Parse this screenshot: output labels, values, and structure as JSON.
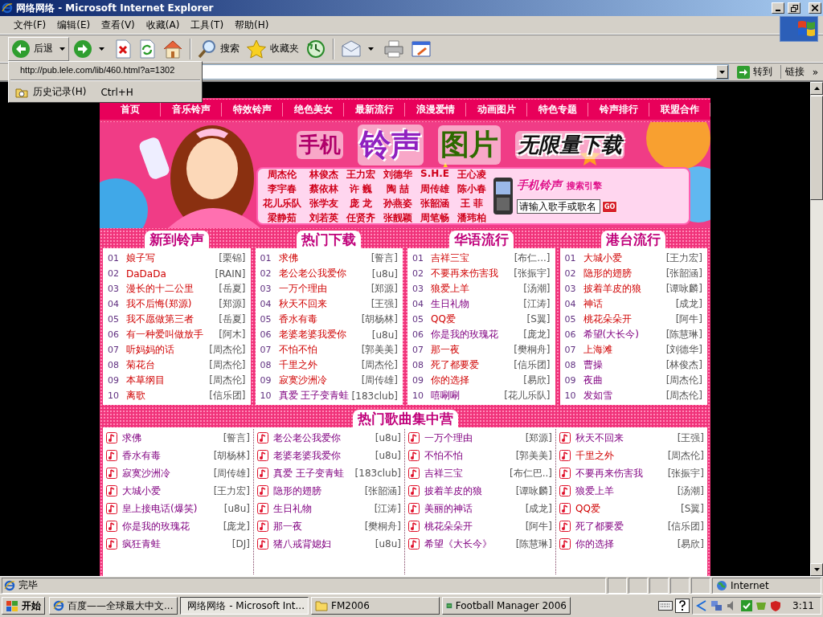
{
  "window": {
    "title": "网络网络 - Microsoft Internet Explorer"
  },
  "menu": [
    "文件(F)",
    "编辑(E)",
    "查看(V)",
    "收藏(A)",
    "工具(T)",
    "帮助(H)"
  ],
  "toolbar": [
    {
      "kind": "back",
      "label": "后退"
    },
    {
      "kind": "forward"
    },
    {
      "kind": "stop"
    },
    {
      "kind": "refresh"
    },
    {
      "kind": "home"
    },
    {
      "kind": "search",
      "label": "搜索"
    },
    {
      "kind": "favorites",
      "label": "收藏夹"
    },
    {
      "kind": "history"
    },
    {
      "kind": "mail"
    },
    {
      "kind": "print"
    },
    {
      "kind": "edit"
    }
  ],
  "address_bar": {
    "go": "转到",
    "links": "链接",
    "chevron": "»"
  },
  "history_menu": {
    "url": "http://pub.lele.com/lib/460.html?a=1302",
    "item": "历史记录(H)",
    "shortcut": "Ctrl+H"
  },
  "page": {
    "nav": [
      "首页",
      "音乐铃声",
      "特效铃声",
      "绝色美女",
      "最新流行",
      "浪漫爱情",
      "动画图片",
      "特色专题",
      "铃声排行",
      "联盟合作"
    ],
    "banner": {
      "headline": [
        "手机",
        "铃声",
        "图片",
        "无限量下载"
      ],
      "singers": [
        "周杰伦",
        "林俊杰",
        "王力宏",
        "刘德华",
        "S.H.E",
        "王心凌",
        "李宇春",
        "蔡依林",
        "许 巍",
        "陶 喆",
        "周传雄",
        "陈小春",
        "花儿乐队",
        "张学友",
        "庞 龙",
        "孙燕姿",
        "张韶涵",
        "王 菲",
        "梁静茹",
        "刘若英",
        "任贤齐",
        "张靓颖",
        "周笔畅",
        "潘玮柏"
      ],
      "search_title": "手机铃声",
      "search_subtitle": "搜索引擎",
      "search_value": "请输入歌手或歌名",
      "go": "GO"
    },
    "panels": [
      {
        "title": "新到铃声",
        "rows": [
          {
            "num": "01",
            "song": "娘子写",
            "artist": "[栗锦]",
            "visited": false
          },
          {
            "num": "02",
            "song": "DaDaDa",
            "artist": "[RAIN]",
            "visited": false
          },
          {
            "num": "03",
            "song": "漫长的十二公里",
            "artist": "[岳夏]",
            "visited": false
          },
          {
            "num": "04",
            "song": "我不后悔(郑源)",
            "artist": "[郑源]",
            "visited": false
          },
          {
            "num": "05",
            "song": "我不愿做第三者",
            "artist": "[岳夏]",
            "visited": false
          },
          {
            "num": "06",
            "song": "有一种爱叫做放手",
            "artist": "[阿木]",
            "visited": false
          },
          {
            "num": "07",
            "song": "听妈妈的话",
            "artist": "[周杰伦]",
            "visited": false
          },
          {
            "num": "08",
            "song": "菊花台",
            "artist": "[周杰伦]",
            "visited": false
          },
          {
            "num": "09",
            "song": "本草纲目",
            "artist": "[周杰伦]",
            "visited": false
          },
          {
            "num": "10",
            "song": "离歌",
            "artist": "[信乐团]",
            "visited": false
          }
        ]
      },
      {
        "title": "热门下载",
        "rows": [
          {
            "num": "01",
            "song": "求佛",
            "artist": "[誓言]",
            "visited": false
          },
          {
            "num": "02",
            "song": "老公老公我爱你",
            "artist": "[u8u]",
            "visited": false
          },
          {
            "num": "03",
            "song": "一万个理由",
            "artist": "[郑源]",
            "visited": false
          },
          {
            "num": "04",
            "song": "秋天不回来",
            "artist": "[王强]",
            "visited": false
          },
          {
            "num": "05",
            "song": "香水有毒",
            "artist": "[胡杨林]",
            "visited": false
          },
          {
            "num": "06",
            "song": "老婆老婆我爱你",
            "artist": "[u8u]",
            "visited": false
          },
          {
            "num": "07",
            "song": "不怕不怕",
            "artist": "[郭美美]",
            "visited": false
          },
          {
            "num": "08",
            "song": "千里之外",
            "artist": "[周杰伦]",
            "visited": false
          },
          {
            "num": "09",
            "song": "寂寞沙洲冷",
            "artist": "[周传雄]",
            "visited": false
          },
          {
            "num": "10",
            "song": "真爱 王子变青蛙",
            "artist": "[183club]",
            "visited": true
          }
        ]
      },
      {
        "title": "华语流行",
        "rows": [
          {
            "num": "01",
            "song": "吉祥三宝",
            "artist": "[布仁...]",
            "visited": false
          },
          {
            "num": "02",
            "song": "不要再来伤害我",
            "artist": "[张振宇]",
            "visited": false
          },
          {
            "num": "03",
            "song": "狼爱上羊",
            "artist": "[汤潮]",
            "visited": false
          },
          {
            "num": "04",
            "song": "生日礼物",
            "artist": "[江涛]",
            "visited": true
          },
          {
            "num": "05",
            "song": "QQ爱",
            "artist": "[S翼]",
            "visited": false
          },
          {
            "num": "06",
            "song": "你是我的玫瑰花",
            "artist": "[庞龙]",
            "visited": true
          },
          {
            "num": "07",
            "song": "那一夜",
            "artist": "[樊桐舟]",
            "visited": false
          },
          {
            "num": "08",
            "song": "死了都要爱",
            "artist": "[信乐团]",
            "visited": false
          },
          {
            "num": "09",
            "song": "你的选择",
            "artist": "[易欣]",
            "visited": false
          },
          {
            "num": "10",
            "song": "嘻唰唰",
            "artist": "[花儿乐队]",
            "visited": true
          }
        ]
      },
      {
        "title": "港台流行",
        "rows": [
          {
            "num": "01",
            "song": "大城小爱",
            "artist": "[王力宏]",
            "visited": false
          },
          {
            "num": "02",
            "song": "隐形的翅膀",
            "artist": "[张韶涵]",
            "visited": false
          },
          {
            "num": "03",
            "song": "披着羊皮的狼",
            "artist": "[谭咏麟]",
            "visited": false
          },
          {
            "num": "04",
            "song": "神话",
            "artist": "[成龙]",
            "visited": false
          },
          {
            "num": "05",
            "song": "桃花朵朵开",
            "artist": "[阿牛]",
            "visited": false
          },
          {
            "num": "06",
            "song": "希望(大长今)",
            "artist": "[陈慧琳]",
            "visited": true
          },
          {
            "num": "07",
            "song": "上海滩",
            "artist": "[刘德华]",
            "visited": false
          },
          {
            "num": "08",
            "song": "曹操",
            "artist": "[林俊杰]",
            "visited": true
          },
          {
            "num": "09",
            "song": "夜曲",
            "artist": "[周杰伦]",
            "visited": true
          },
          {
            "num": "10",
            "song": "发如雪",
            "artist": "[周杰伦]",
            "visited": true
          }
        ]
      }
    ],
    "hot": {
      "title": "热门歌曲集中营",
      "columns": [
        [
          {
            "song": "求佛",
            "artist": "[誓言]",
            "visited": true
          },
          {
            "song": "香水有毒",
            "artist": "[胡杨林]",
            "visited": true
          },
          {
            "song": "寂寞沙洲冷",
            "artist": "[周传雄]",
            "visited": true
          },
          {
            "song": "大城小爱",
            "artist": "[王力宏]",
            "visited": true
          },
          {
            "song": "皇上接电话(爆笑)",
            "artist": "[u8u]",
            "visited": true
          },
          {
            "song": "你是我的玫瑰花",
            "artist": "[庞龙]",
            "visited": true
          },
          {
            "song": "疯狂青蛙",
            "artist": "[DJ]",
            "visited": true
          }
        ],
        [
          {
            "song": "老公老公我爱你",
            "artist": "[u8u]",
            "visited": true
          },
          {
            "song": "老婆老婆我爱你",
            "artist": "[u8u]",
            "visited": true
          },
          {
            "song": "真爱 王子变青蛙",
            "artist": "[183club]",
            "visited": true
          },
          {
            "song": "隐形的翅膀",
            "artist": "[张韶涵]",
            "visited": true
          },
          {
            "song": "生日礼物",
            "artist": "[江涛]",
            "visited": true
          },
          {
            "song": "那一夜",
            "artist": "[樊桐舟]",
            "visited": true
          },
          {
            "song": "猪八戒背媳妇",
            "artist": "[u8u]",
            "visited": true
          }
        ],
        [
          {
            "song": "一万个理由",
            "artist": "[郑源]",
            "visited": true
          },
          {
            "song": "不怕不怕",
            "artist": "[郭美美]",
            "visited": true
          },
          {
            "song": "吉祥三宝",
            "artist": "[布仁巴..]",
            "visited": true
          },
          {
            "song": "披着羊皮的狼",
            "artist": "[谭咏麟]",
            "visited": true
          },
          {
            "song": "美丽的神话",
            "artist": "[成龙]",
            "visited": true
          },
          {
            "song": "桃花朵朵开",
            "artist": "[阿牛]",
            "visited": true
          },
          {
            "song": "希望《大长今》",
            "artist": "[陈慧琳]",
            "visited": true
          }
        ],
        [
          {
            "song": "秋天不回来",
            "artist": "[王强]",
            "visited": true
          },
          {
            "song": "千里之外",
            "artist": "[周杰伦]",
            "visited": false
          },
          {
            "song": "不要再来伤害我",
            "artist": "[张振宇]",
            "visited": true
          },
          {
            "song": "狼爱上羊",
            "artist": "[汤潮]",
            "visited": true
          },
          {
            "song": "QQ爱",
            "artist": "[S翼]",
            "visited": false
          },
          {
            "song": "死了都要爱",
            "artist": "[信乐团]",
            "visited": true
          },
          {
            "song": "你的选择",
            "artist": "[易欣]",
            "visited": true
          }
        ]
      ]
    }
  },
  "status_bar": {
    "text": "完毕",
    "zone": "Internet"
  },
  "taskbar": {
    "start": "开始",
    "tasks": [
      {
        "kind": "browser",
        "label": "百度——全球最大中文...",
        "selected": false
      },
      {
        "kind": "browser",
        "label": "网络网络 - Microsoft Int...",
        "selected": true
      },
      {
        "kind": "folder",
        "label": "FM2006",
        "selected": false
      },
      {
        "kind": "game",
        "label": "Football Manager 2006",
        "selected": false
      }
    ],
    "clock": "3:11"
  }
}
